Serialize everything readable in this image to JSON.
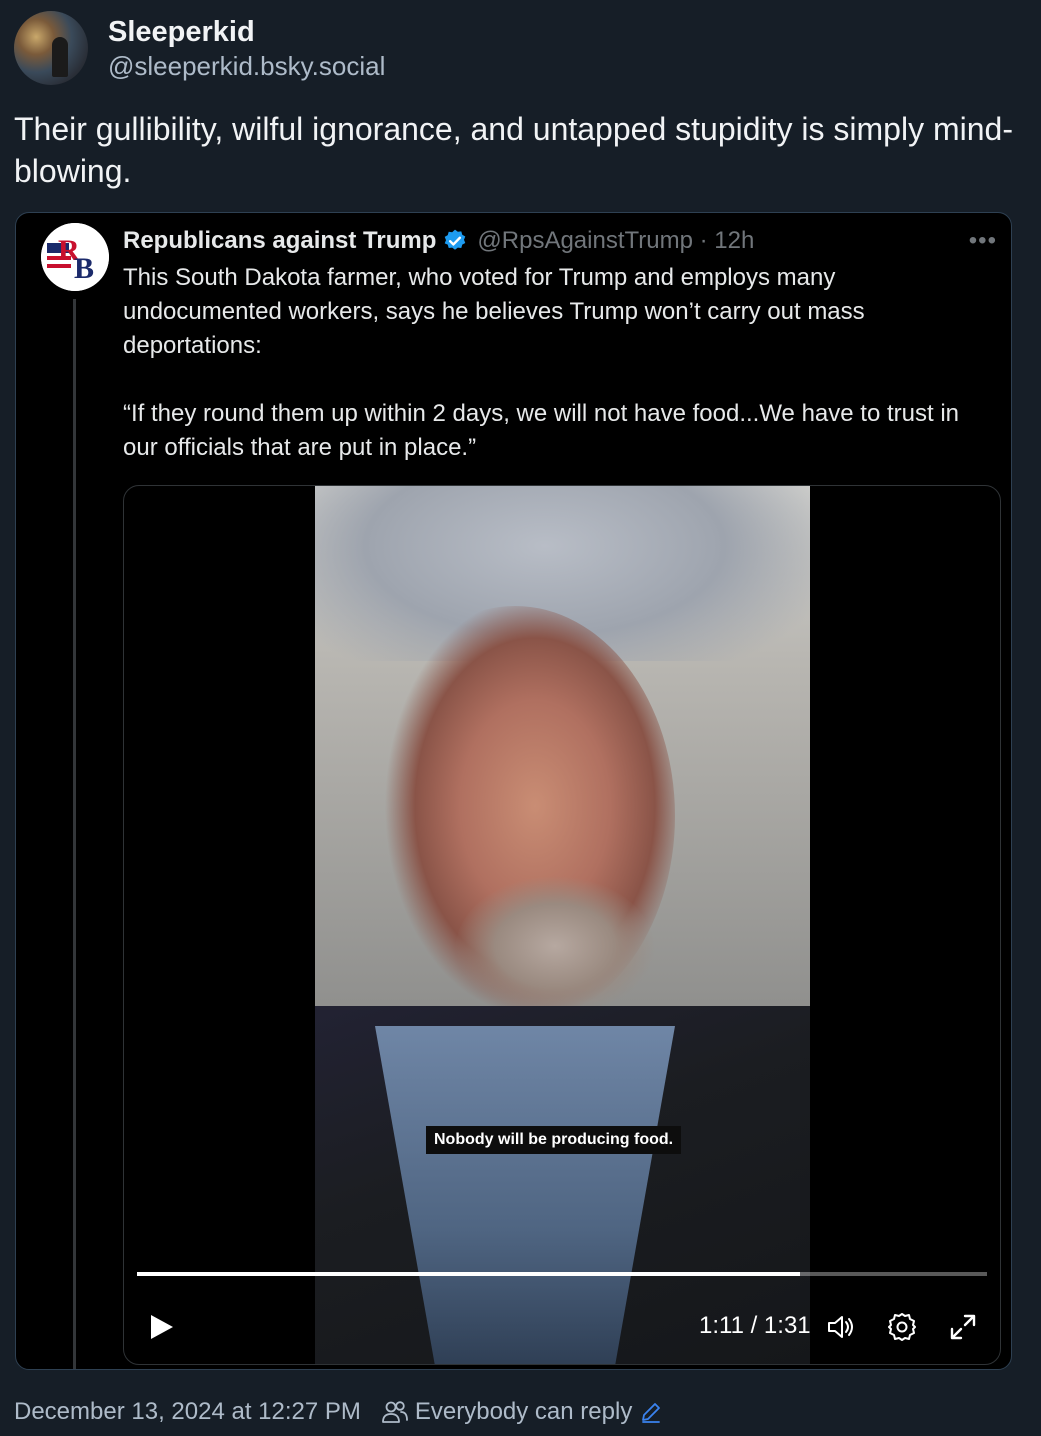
{
  "post": {
    "author": {
      "display_name": "Sleeperkid",
      "handle": "@sleeperkid.bsky.social"
    },
    "text": "Their gullibility, wilful ignorance, and untapped stupidity is simply mind-blowing."
  },
  "quote": {
    "author": {
      "display_name": "Republicans against Trump",
      "handle": "@RpsAgainstTrump",
      "separator": "·",
      "time": "12h",
      "verified": true,
      "avatar_letters": "RB"
    },
    "more_label": "•••",
    "paragraphs": [
      "This South Dakota farmer, who voted for Trump and employs many undocumented workers, says he believes Trump won’t carry out mass deportations:",
      "“If they round them up within 2 days, we will not have food...We have to trust in our officials that are put in place.”"
    ],
    "video": {
      "caption": "Nobody will be producing food.",
      "current_time": "1:11",
      "duration": "1:31",
      "time_display": "1:11 / 1:31",
      "progress": 0.78,
      "icons": [
        "play-icon",
        "volume-icon",
        "settings-icon",
        "fullscreen-icon"
      ]
    }
  },
  "footer": {
    "timestamp": "December 13, 2024 at 12:27 PM",
    "reply_setting": "Everybody can reply"
  },
  "colors": {
    "background": "#161e27",
    "quote_background": "#000000",
    "verified_blue": "#1d9bf0",
    "secondary_text": "#aebbc9"
  }
}
